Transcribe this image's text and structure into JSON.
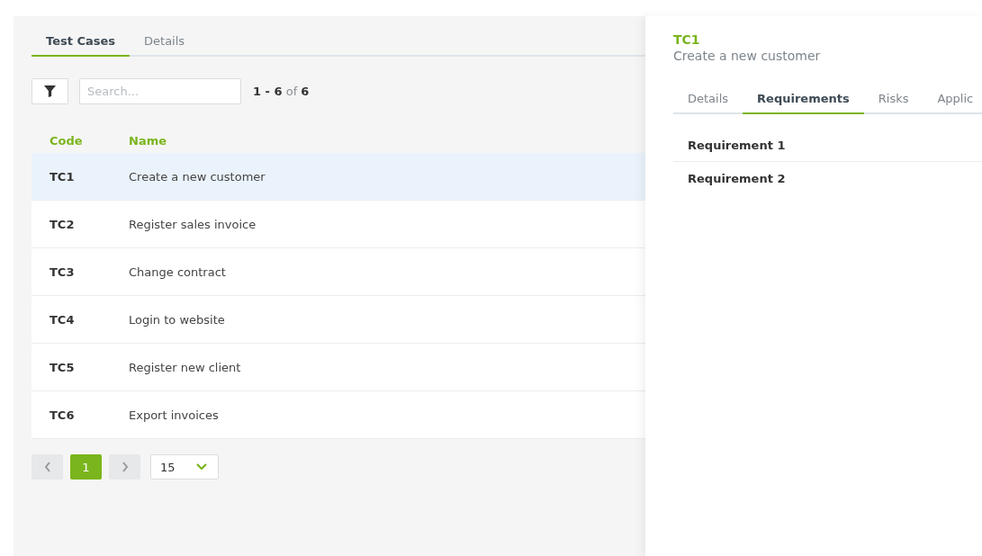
{
  "left_tabs": [
    {
      "label": "Test Cases",
      "selected": true
    },
    {
      "label": "Details",
      "selected": false
    }
  ],
  "search": {
    "placeholder": "Search..."
  },
  "range": {
    "from_to": "1 - 6",
    "of": "of",
    "total": "6"
  },
  "table": {
    "columns": [
      "Code",
      "Name"
    ],
    "rows": [
      {
        "code": "TC1",
        "name": "Create a new customer",
        "selected": true
      },
      {
        "code": "TC2",
        "name": "Register sales invoice",
        "selected": false
      },
      {
        "code": "TC3",
        "name": "Change contract",
        "selected": false
      },
      {
        "code": "TC4",
        "name": "Login to website",
        "selected": false
      },
      {
        "code": "TC5",
        "name": "Register new client",
        "selected": false
      },
      {
        "code": "TC6",
        "name": "Export invoices",
        "selected": false
      }
    ]
  },
  "pagination": {
    "pages": [
      {
        "label": "1",
        "selected": true
      }
    ],
    "page_size": "15"
  },
  "detail": {
    "code": "TC1",
    "title": "Create a new customer",
    "tabs": [
      {
        "label": "Details",
        "selected": false
      },
      {
        "label": "Requirements",
        "selected": true
      },
      {
        "label": "Risks",
        "selected": false
      },
      {
        "label": "Applic",
        "selected": false
      }
    ],
    "requirements": [
      "Requirement 1",
      "Requirement 2"
    ]
  }
}
